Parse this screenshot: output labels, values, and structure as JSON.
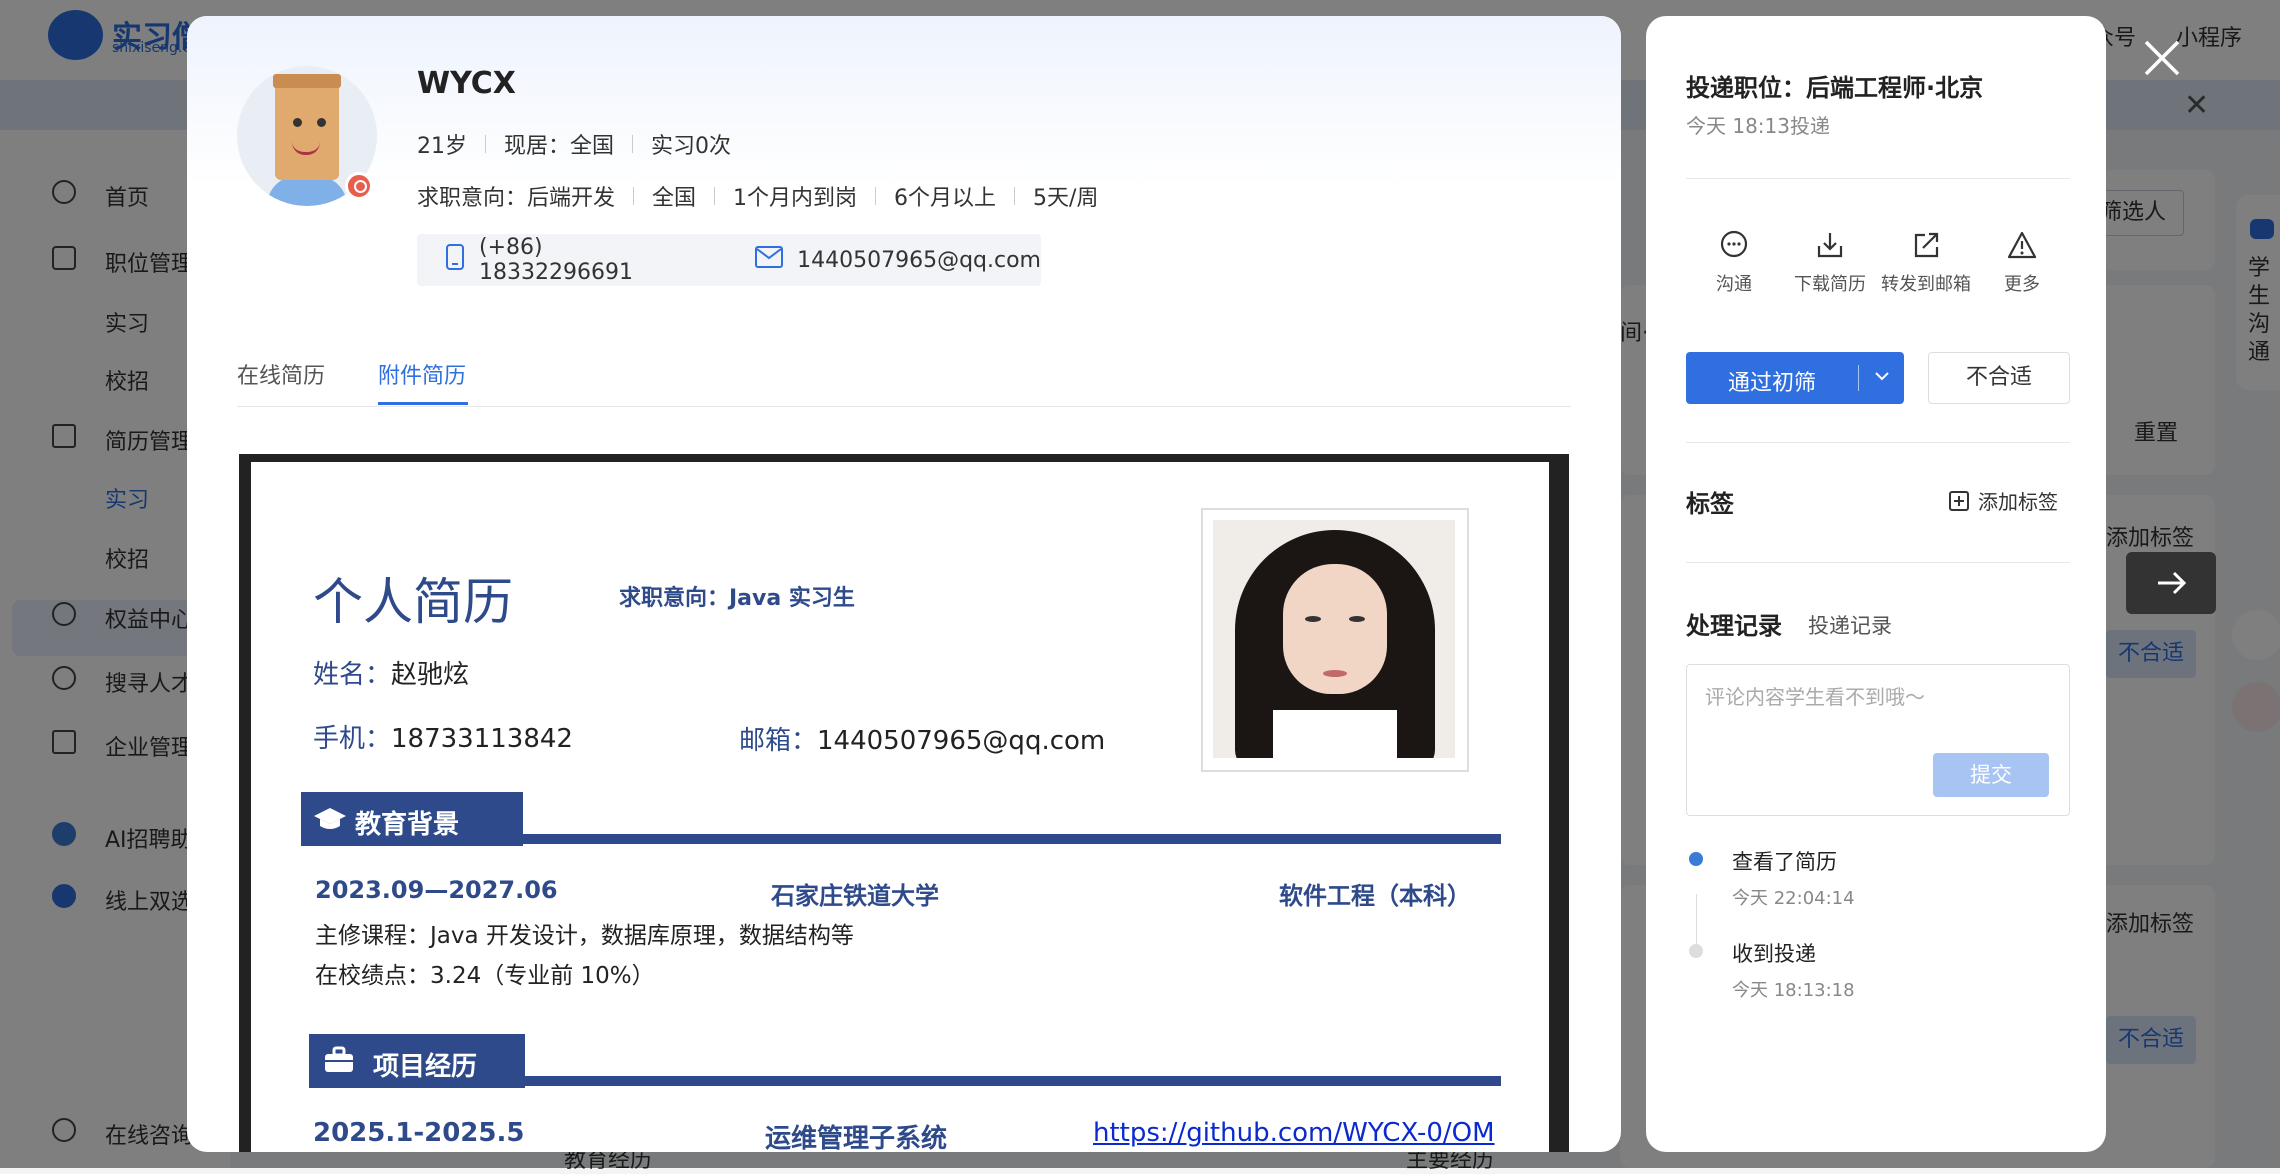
{
  "background": {
    "logo_text": "实习僧",
    "logo_sub": "shixiseng.com",
    "top_links": [
      "公众号",
      "小程序"
    ],
    "sidebar": [
      {
        "label": "首页",
        "top": 0
      },
      {
        "label": "职位管理",
        "top": 0
      },
      {
        "label": "实习",
        "top": 0
      },
      {
        "label": "校招",
        "top": 0
      },
      {
        "label": "简历管理",
        "top": 0
      },
      {
        "label": "实习",
        "top": 0
      },
      {
        "label": "校招",
        "top": 0
      },
      {
        "label": "权益中心",
        "top": 0
      },
      {
        "label": "搜寻人才",
        "top": 0
      },
      {
        "label": "企业管理",
        "top": 0
      },
      {
        "label": "AI招聘助手",
        "top": 0
      },
      {
        "label": "线上双选会",
        "top": 0
      },
      {
        "label": "在线咨询",
        "top": 0
      }
    ],
    "buttons": {
      "filter": "筛选人",
      "reset": "重置",
      "add_tag1": "添加标签",
      "reject1": "不合适",
      "add_tag2": "添加标签",
      "reject2": "不合适"
    },
    "bottom_labels": [
      "教育经历",
      "主要经历"
    ],
    "float_chat": "学生沟通",
    "mid_text": "间·"
  },
  "candidate": {
    "name": "WYCX",
    "age": "21岁",
    "location": "现居：全国",
    "internships": "实习0次",
    "intent_label": "求职意向：后端开发",
    "intent_area": "全国",
    "arrival": "1个月内到岗",
    "duration": "6个月以上",
    "days": "5天/周",
    "phone": "(+86) 18332296691",
    "email": "1440507965@qq.com"
  },
  "tabs": {
    "online": "在线简历",
    "attachment": "附件简历"
  },
  "resume": {
    "title": "个人简历",
    "intent": "求职意向：Java 实习生",
    "name_label": "姓名：",
    "name_value": "赵驰炫",
    "phone_label": "手机：",
    "phone_value": "18733113842",
    "email_label": "邮箱：",
    "email_value": "1440507965@qq.com",
    "edu_heading": "教育背景",
    "edu_period": "2023.09—2027.06",
    "edu_school": "石家庄铁道大学",
    "edu_major": "软件工程（本科）",
    "edu_courses": "主修课程：Java 开发设计，数据库原理，数据结构等",
    "edu_gpa": "在校绩点：3.24（专业前 10%）",
    "proj_heading": "项目经历",
    "proj_period": "2025.1-2025.5",
    "proj_name": "运维管理子系统",
    "proj_link": "https://github.com/WYCX-0/OM"
  },
  "side": {
    "position": "投递职位：后端工程师·北京",
    "applied_time": "今天 18:13投递",
    "actions": [
      "沟通",
      "下载简历",
      "转发到邮箱",
      "更多"
    ],
    "pass_button": "通过初筛",
    "reject_button": "不合适",
    "tag_title": "标签",
    "add_tag": "添加标签",
    "records_title": "处理记录",
    "records_tab2": "投递记录",
    "comment_placeholder": "评论内容学生看不到哦～",
    "submit": "提交",
    "timeline": [
      {
        "event": "查看了简历",
        "time": "今天 22:04:14"
      },
      {
        "event": "收到投递",
        "time": "今天 18:13:18"
      }
    ]
  },
  "colors": {
    "accent": "#2f6fe0",
    "resume_navy": "#2e4a8a",
    "overlay": "rgba(0,0,0,0.5)"
  }
}
